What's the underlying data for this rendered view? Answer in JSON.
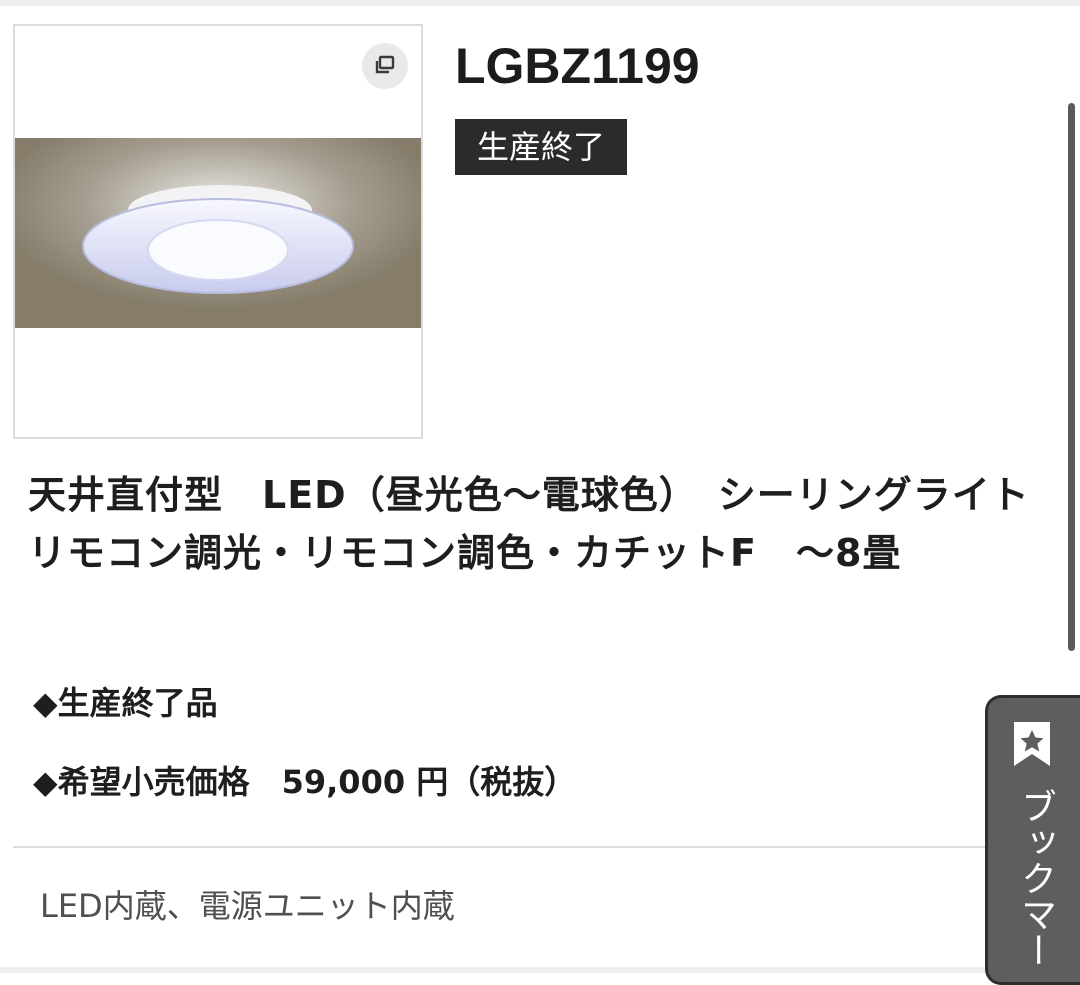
{
  "product": {
    "model": "LGBZ1199",
    "status_badge": "生産終了",
    "title": "天井直付型　LED（昼光色〜電球色）　シーリングライト　リモコン調光・リモコン調色・カチットF　〜8畳",
    "specs": [
      "◆生産終了品",
      "◆希望小売価格　59,000 円（税抜）"
    ],
    "feature": "LED内蔵、電源ユニット内蔵"
  },
  "image": {
    "wall_color": "#857c6a",
    "fixture_color": "#e6e8f8"
  },
  "icons": {
    "expand": "expand-window-icon",
    "bookmark": "bookmark-star-icon"
  },
  "bookmark": {
    "label": "ブックマー"
  },
  "colors": {
    "badge_bg": "#2b2b2b",
    "bookmark_bg": "#5e5e5e",
    "text": "#1e1e1e"
  }
}
